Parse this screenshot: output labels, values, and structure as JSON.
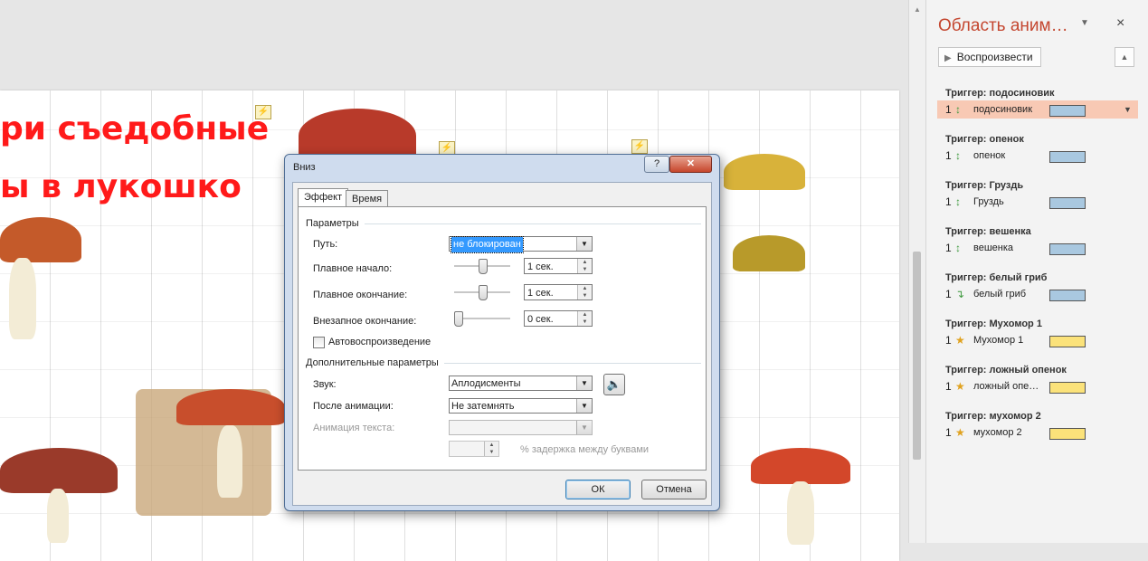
{
  "slide": {
    "title_line1": "ри съедобные",
    "title_line2": "ы в лукошко",
    "trigger_marker": "⚡"
  },
  "pane": {
    "title": "Область аним…",
    "menu_icon": "chevron-down-icon",
    "close_icon": "×",
    "play_label": "Воспроизвести",
    "up_arrow": "▲",
    "triggers": [
      {
        "header": "Триггер: подосиновик",
        "num": "1",
        "icon": "entrance-path",
        "label": "подосиновик",
        "bar_color": "#a9c8e0",
        "selected": true
      },
      {
        "header": "Триггер: опенок",
        "num": "1",
        "icon": "entrance-path",
        "label": "опенок",
        "bar_color": "#a9c8e0",
        "selected": false
      },
      {
        "header": "Триггер: Груздь",
        "num": "1",
        "icon": "entrance-path",
        "label": "Груздь",
        "bar_color": "#a9c8e0",
        "selected": false
      },
      {
        "header": "Триггер: вешенка",
        "num": "1",
        "icon": "entrance-path",
        "label": "вешенка",
        "bar_color": "#a9c8e0",
        "selected": false
      },
      {
        "header": "Триггер: белый гриб",
        "num": "1",
        "icon": "motion-path",
        "label": "белый гриб",
        "bar_color": "#a9c8e0",
        "selected": false
      },
      {
        "header": "Триггер: Мухомор 1",
        "num": "1",
        "icon": "star",
        "label": "Мухомор 1",
        "bar_color": "#fbe27a",
        "selected": false
      },
      {
        "header": "Триггер: ложный опенок",
        "num": "1",
        "icon": "star",
        "label": "ложный опе…",
        "bar_color": "#fbe27a",
        "selected": false
      },
      {
        "header": "Триггер: мухомор 2",
        "num": "1",
        "icon": "star",
        "label": "мухомор 2",
        "bar_color": "#fbe27a",
        "selected": false
      }
    ]
  },
  "dialog": {
    "title": "Вниз",
    "help": "?",
    "close": "✕",
    "tabs": [
      "Эффект",
      "Время"
    ],
    "section_params": "Параметры",
    "path_label": "Путь:",
    "path_value": "не блокирован",
    "smooth_start_label": "Плавное начало:",
    "smooth_start_value": "1 сек.",
    "smooth_start_level": 0.5,
    "smooth_end_label": "Плавное окончание:",
    "smooth_end_value": "1 сек.",
    "smooth_end_level": 0.5,
    "abrupt_end_label": "Внезапное окончание:",
    "abrupt_end_value": "0 сек.",
    "abrupt_end_level": 0.0,
    "autoreverse_label": "Автовоспроизведение",
    "section_extra": "Дополнительные параметры",
    "sound_label": "Звук:",
    "sound_value": "Аплодисменты",
    "after_label": "После анимации:",
    "after_value": "Не затемнять",
    "text_anim_label": "Анимация текста:",
    "text_anim_value": "",
    "delay_label": "% задержка между буквами",
    "ok": "ОК",
    "cancel": "Отмена"
  },
  "colors": {
    "pane_title": "#c4462f",
    "slide_title": "#ff1a1a",
    "selection": "#f8c9b4"
  }
}
